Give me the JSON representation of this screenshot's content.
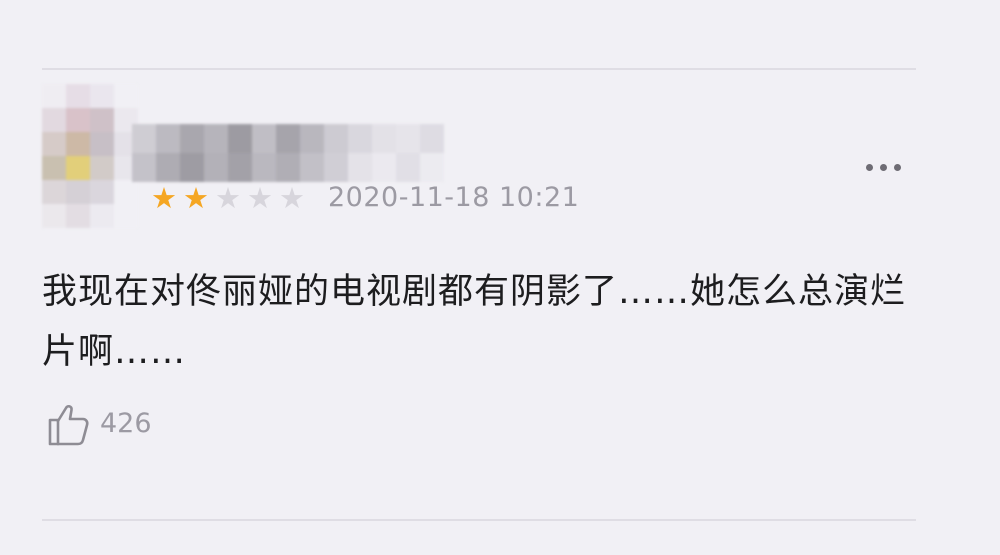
{
  "comment": {
    "rating": 2,
    "rating_max": 5,
    "timestamp": "2020-11-18 10:21",
    "text": "我现在对佟丽娅的电视剧都有阴影了……她怎么总演烂片啊……",
    "like_count": "426"
  },
  "icons": {
    "more": "more-dots-icon",
    "like": "thumbs-up-icon",
    "star": "star-icon"
  },
  "colors": {
    "background": "#f1f0f5",
    "star_active": "#f5a623",
    "star_inactive": "#d7d5dc",
    "muted_text": "#9c9aa3",
    "divider": "#dfdde4"
  }
}
